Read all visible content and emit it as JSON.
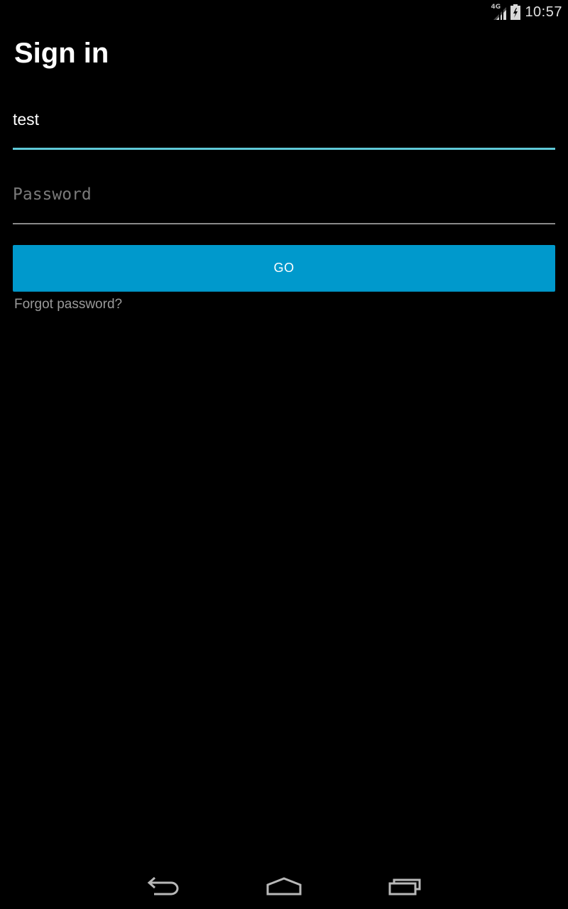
{
  "status_bar": {
    "network_label": "4G",
    "time": "10:57",
    "icons": [
      "signal-icon",
      "battery-icon"
    ]
  },
  "page": {
    "title": "Sign in"
  },
  "form": {
    "username_value": "test",
    "password_placeholder": "Password",
    "go_label": "GO",
    "forgot_label": "Forgot password?"
  },
  "nav_bar": {
    "icons": [
      "back-icon",
      "home-icon",
      "recents-icon"
    ]
  },
  "colors": {
    "background": "#000000",
    "accent_underline": "#5fc9d8",
    "button": "#0099cc",
    "secondary_text": "#9a9a9a"
  }
}
